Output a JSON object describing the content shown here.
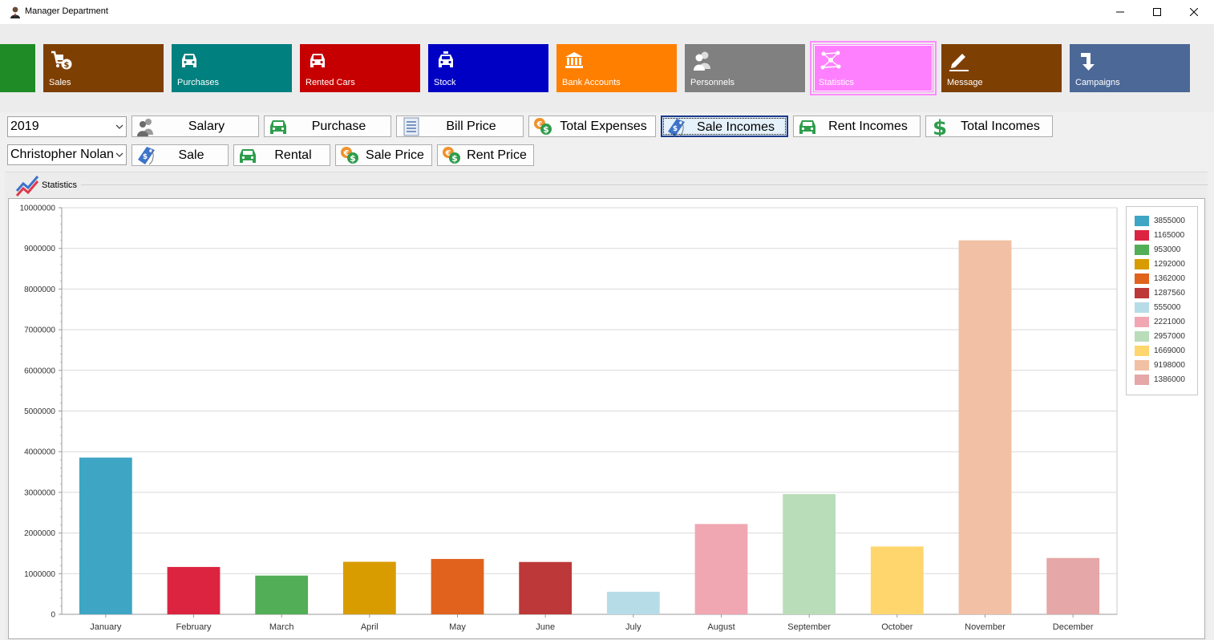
{
  "window": {
    "title": "Manager Department",
    "controls": [
      "minimize",
      "maximize",
      "close"
    ]
  },
  "tiles": [
    {
      "label": "",
      "color": "#1f8b26",
      "icon": "none"
    },
    {
      "label": "Sales",
      "color": "#7e3f03",
      "icon": "cart-dollar-icon"
    },
    {
      "label": "Purchases",
      "color": "#00807f",
      "icon": "car-icon"
    },
    {
      "label": "Rented Cars",
      "color": "#c60000",
      "icon": "car-icon"
    },
    {
      "label": "Stock",
      "color": "#0000c5",
      "icon": "taxi-icon"
    },
    {
      "label": "Bank Accounts",
      "color": "#ff7f00",
      "icon": "bank-icon"
    },
    {
      "label": "Personnels",
      "color": "#808080",
      "icon": "people-icon"
    },
    {
      "label": "Statistics",
      "color": "#ff80ff",
      "icon": "network-icon",
      "selected": true
    },
    {
      "label": "Message",
      "color": "#7e3f03",
      "icon": "pencil-icon"
    },
    {
      "label": "Campaigns",
      "color": "#4b6897",
      "icon": "arrow-down-icon"
    }
  ],
  "filters": {
    "year": "2019",
    "person": "Christopher Nolan"
  },
  "buttons_row1": [
    {
      "label": "Salary",
      "icon": "people-icon"
    },
    {
      "label": "Purchase",
      "icon": "car-green-icon"
    },
    {
      "label": "Bill Price",
      "icon": "bill-icon"
    },
    {
      "label": "Total Expenses",
      "icon": "coins-icon"
    },
    {
      "label": "Sale Incomes",
      "icon": "price-tag-icon",
      "focused": true
    },
    {
      "label": "Rent Incomes",
      "icon": "car-green-icon"
    },
    {
      "label": "Total Incomes",
      "icon": "dollar-icon"
    }
  ],
  "buttons_row2": [
    {
      "label": "Sale",
      "icon": "price-tag-icon"
    },
    {
      "label": "Rental",
      "icon": "car-green-icon"
    },
    {
      "label": "Sale Price",
      "icon": "coins-icon"
    },
    {
      "label": "Rent Price",
      "icon": "coins-icon"
    }
  ],
  "group": {
    "title": "Statistics"
  },
  "chart_data": {
    "type": "bar",
    "title": "",
    "xlabel": "",
    "ylabel": "",
    "categories": [
      "January",
      "February",
      "March",
      "April",
      "May",
      "June",
      "July",
      "August",
      "September",
      "October",
      "November",
      "December"
    ],
    "values": [
      3855000,
      1165000,
      953000,
      1292000,
      1362000,
      1287560,
      555000,
      2221000,
      2957000,
      1669000,
      9198000,
      1386000
    ],
    "colors": [
      "#3ea5c4",
      "#dc2441",
      "#52ae57",
      "#d89c00",
      "#e0621d",
      "#bd3838",
      "#b6dce8",
      "#f0a7b2",
      "#b9ddb9",
      "#fed66d",
      "#f2c0a4",
      "#e5a7a7"
    ],
    "legend_entries": [
      "3855000",
      "1165000",
      "953000",
      "1292000",
      "1362000",
      "1287560",
      "555000",
      "2221000",
      "2957000",
      "1669000",
      "9198000",
      "1386000"
    ],
    "ylim": [
      0,
      10000000
    ],
    "yticks": [
      "0",
      "1000000",
      "2000000",
      "3000000",
      "4000000",
      "5000000",
      "6000000",
      "7000000",
      "8000000",
      "9000000",
      "10000000"
    ],
    "grid": true,
    "legend_position": "right"
  }
}
